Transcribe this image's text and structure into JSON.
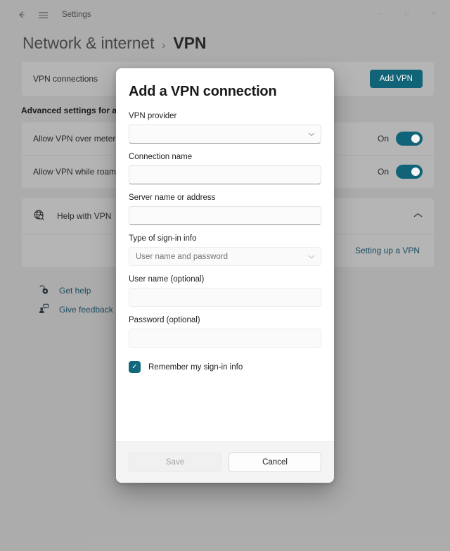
{
  "titlebar": {
    "back_icon": "back-arrow-icon",
    "menu_icon": "hamburger-menu-icon",
    "title": "Settings",
    "minimize": "–",
    "maximize": "□",
    "close": "×"
  },
  "header": {
    "parent": "Network & internet",
    "separator": "›",
    "current": "VPN"
  },
  "vpn_connections": {
    "label": "VPN connections",
    "add_button": "Add VPN"
  },
  "advanced": {
    "section_title": "Advanced settings for all VPN",
    "rows": [
      {
        "label": "Allow VPN over metered n",
        "state": "On"
      },
      {
        "label": "Allow VPN while roaming",
        "state": "On"
      }
    ]
  },
  "help_card": {
    "icon": "globe-search-icon",
    "label": "Help with VPN",
    "chevron": "⌃",
    "sub_link": "Setting up a VPN"
  },
  "footer_links": [
    {
      "icon": "get-help-icon",
      "glyph": "⌘",
      "label": "Get help"
    },
    {
      "icon": "give-feedback-icon",
      "glyph": "⚑",
      "label": "Give feedback"
    }
  ],
  "dialog": {
    "title": "Add a VPN connection",
    "fields": [
      {
        "label": "VPN provider",
        "value": "",
        "placeholder": "",
        "type": "select",
        "disabled": false
      },
      {
        "label": "Connection name",
        "value": "",
        "placeholder": "",
        "type": "text",
        "disabled": false
      },
      {
        "label": "Server name or address",
        "value": "",
        "placeholder": "",
        "type": "text",
        "disabled": false
      },
      {
        "label": "Type of sign-in info",
        "value": "",
        "placeholder": "User name and password",
        "type": "select",
        "disabled": true
      },
      {
        "label": "User name (optional)",
        "value": "",
        "placeholder": "",
        "type": "text",
        "disabled": true
      },
      {
        "label": "Password (optional)",
        "value": "",
        "placeholder": "",
        "type": "text",
        "disabled": true
      }
    ],
    "checkbox": {
      "label": "Remember my sign-in info",
      "checked": true,
      "mark": "✓"
    },
    "save_label": "Save",
    "cancel_label": "Cancel"
  },
  "colors": {
    "accent": "#12697c",
    "link": "#1c4f63",
    "page_bg": "#b4b4b4",
    "card_bg": "#bdbdbd",
    "dialog_bg": "#ffffff",
    "footer_bg": "#f4f4f4"
  }
}
